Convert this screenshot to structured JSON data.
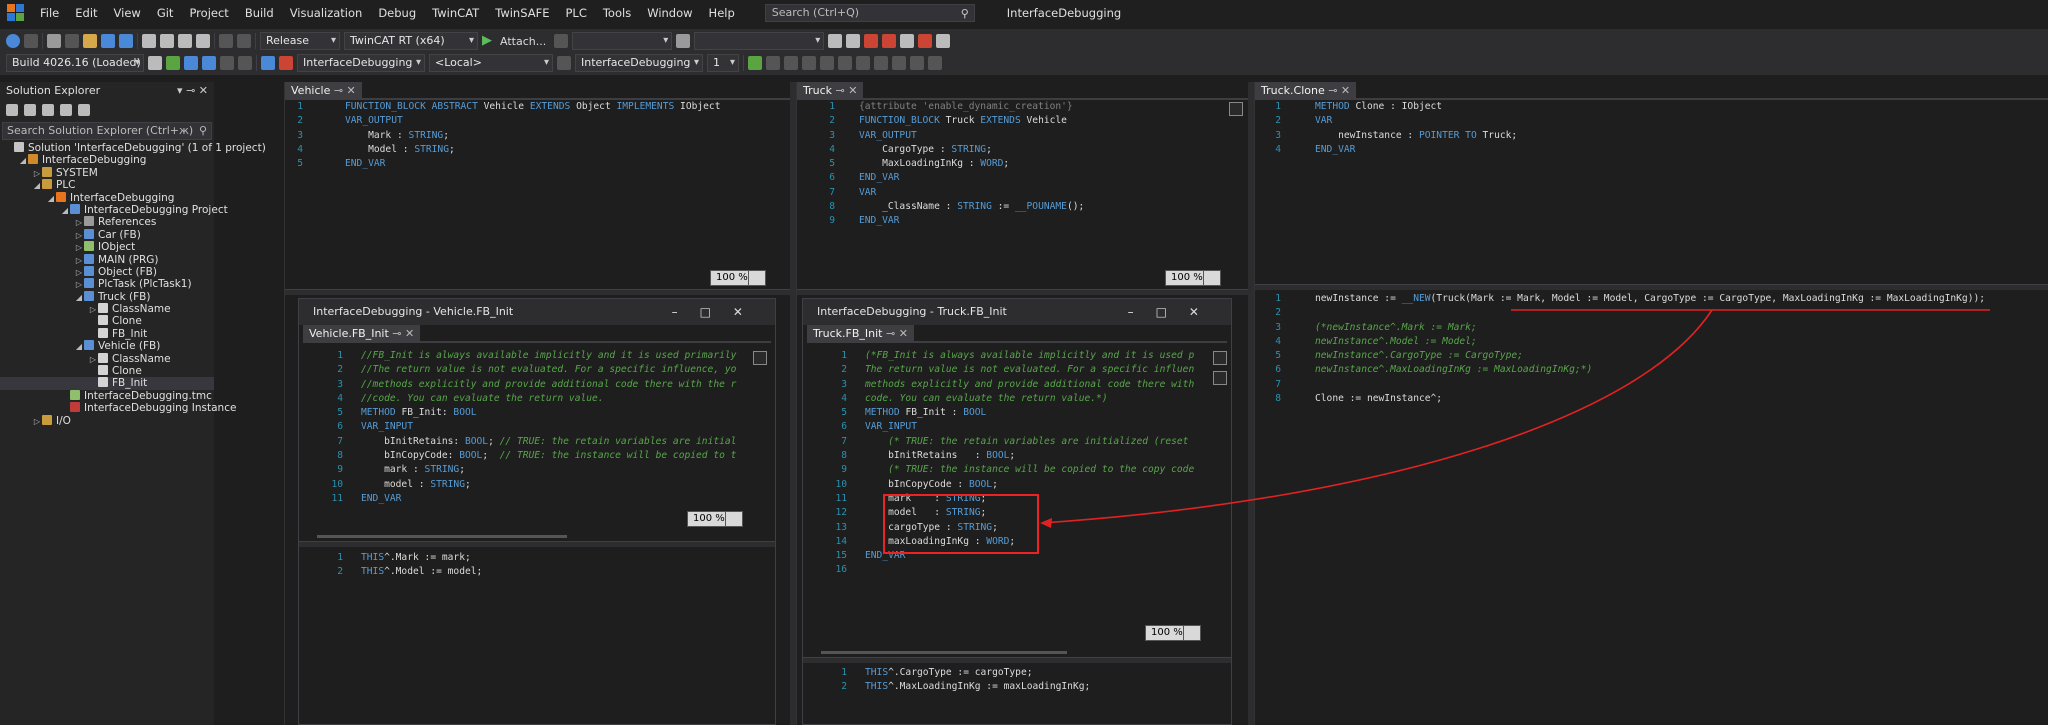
{
  "menubar": {
    "items": [
      "File",
      "Edit",
      "View",
      "Git",
      "Project",
      "Build",
      "Visualization",
      "Debug",
      "TwinCAT",
      "TwinSAFE",
      "PLC",
      "Tools",
      "Window",
      "Help"
    ],
    "search_placeholder": "Search (Ctrl+Q)",
    "app_title": "InterfaceDebugging"
  },
  "toolbar1": {
    "config": "Release",
    "platform": "TwinCAT RT (x64)",
    "attach": "Attach...",
    "empty1": "",
    "empty2": ""
  },
  "toolbar2": {
    "build": "Build 4026.16 (Loaded)",
    "project": "InterfaceDebugging",
    "target": "<Local>",
    "plc": "InterfaceDebugging",
    "task": "1"
  },
  "solution_explorer": {
    "title": "Solution Explorer",
    "search_placeholder": "Search Solution Explorer (Ctrl+ж)",
    "items": [
      {
        "label": "Solution 'InterfaceDebugging' (1 of 1 project)",
        "indent": 0,
        "arrow": "",
        "color": "#c5c5c5"
      },
      {
        "label": "InterfaceDebugging",
        "indent": 1,
        "arrow": "◢",
        "color": "#d08a2a"
      },
      {
        "label": "SYSTEM",
        "indent": 2,
        "arrow": "▷",
        "color": "#c89b3c"
      },
      {
        "label": "PLC",
        "indent": 2,
        "arrow": "◢",
        "color": "#c89b3c"
      },
      {
        "label": "InterfaceDebugging",
        "indent": 3,
        "arrow": "◢",
        "color": "#e8741e"
      },
      {
        "label": "InterfaceDebugging Project",
        "indent": 4,
        "arrow": "◢",
        "color": "#5a8fd6"
      },
      {
        "label": "References",
        "indent": 5,
        "arrow": "▷",
        "color": "#9a9a9a"
      },
      {
        "label": "Car (FB)",
        "indent": 5,
        "arrow": "▷",
        "color": "#5a8fd6"
      },
      {
        "label": "IObject",
        "indent": 5,
        "arrow": "▷",
        "color": "#8fbf6a"
      },
      {
        "label": "MAIN (PRG)",
        "indent": 5,
        "arrow": "▷",
        "color": "#5a8fd6"
      },
      {
        "label": "Object (FB)",
        "indent": 5,
        "arrow": "▷",
        "color": "#5a8fd6"
      },
      {
        "label": "PlcTask (PlcTask1)",
        "indent": 5,
        "arrow": "▷",
        "color": "#5a8fd6"
      },
      {
        "label": "Truck (FB)",
        "indent": 5,
        "arrow": "◢",
        "color": "#5a8fd6"
      },
      {
        "label": "ClassName",
        "indent": 6,
        "arrow": "▷",
        "color": "#d4d4d4"
      },
      {
        "label": "Clone",
        "indent": 6,
        "arrow": "",
        "color": "#d4d4d4"
      },
      {
        "label": "FB_Init",
        "indent": 6,
        "arrow": "",
        "color": "#d4d4d4"
      },
      {
        "label": "Vehicle (FB)",
        "indent": 5,
        "arrow": "◢",
        "color": "#5a8fd6"
      },
      {
        "label": "ClassName",
        "indent": 6,
        "arrow": "▷",
        "color": "#d4d4d4"
      },
      {
        "label": "Clone",
        "indent": 6,
        "arrow": "",
        "color": "#d4d4d4"
      },
      {
        "label": "FB_Init",
        "indent": 6,
        "arrow": "",
        "color": "#d4d4d4",
        "selected": true
      },
      {
        "label": "InterfaceDebugging.tmc",
        "indent": 4,
        "arrow": "",
        "color": "#8fbf6a"
      },
      {
        "label": "InterfaceDebugging Instance",
        "indent": 4,
        "arrow": "",
        "color": "#c23b3b"
      },
      {
        "label": "I/O",
        "indent": 2,
        "arrow": "▷",
        "color": "#c89b3c"
      }
    ]
  },
  "vehicle": {
    "tab": "Vehicle",
    "zoom": "100 %",
    "lines": [
      "1",
      "2",
      "3",
      "4",
      "5"
    ],
    "code": [
      [
        [
          "kw",
          "FUNCTION_BLOCK ABSTRACT "
        ],
        [
          "",
          "Vehicle "
        ],
        [
          "kw",
          "EXTENDS "
        ],
        [
          "",
          "Object "
        ],
        [
          "kw",
          "IMPLEMENTS "
        ],
        [
          "",
          "IObject"
        ]
      ],
      [
        [
          "kw",
          "VAR_OUTPUT"
        ]
      ],
      [
        [
          "",
          "    Mark : "
        ],
        [
          "kw",
          "STRING"
        ],
        [
          "",
          ";"
        ]
      ],
      [
        [
          "",
          "    Model : "
        ],
        [
          "kw",
          "STRING"
        ],
        [
          "",
          ";"
        ]
      ],
      [
        [
          "kw",
          "END_VAR"
        ]
      ]
    ]
  },
  "truck": {
    "tab": "Truck",
    "zoom": "100 %",
    "lines": [
      "1",
      "2",
      "3",
      "4",
      "5",
      "6",
      "7",
      "8",
      "9"
    ],
    "code": [
      [
        [
          "gray",
          "{attribute 'enable_dynamic_creation'}"
        ]
      ],
      [
        [
          "kw",
          "FUNCTION_BLOCK "
        ],
        [
          "",
          "Truck "
        ],
        [
          "kw",
          "EXTENDS "
        ],
        [
          "",
          "Vehicle"
        ]
      ],
      [
        [
          "kw",
          "VAR_OUTPUT"
        ]
      ],
      [
        [
          "",
          "    CargoType : "
        ],
        [
          "kw",
          "STRING"
        ],
        [
          "",
          ";"
        ]
      ],
      [
        [
          "",
          "    MaxLoadingInKg : "
        ],
        [
          "kw",
          "WORD"
        ],
        [
          "",
          ";"
        ]
      ],
      [
        [
          "kw",
          "END_VAR"
        ]
      ],
      [
        [
          "kw",
          "VAR"
        ]
      ],
      [
        [
          "",
          "    _ClassName : "
        ],
        [
          "kw",
          "STRING "
        ],
        [
          "",
          ":= "
        ],
        [
          "kw",
          "__POUNAME"
        ],
        [
          "",
          "();"
        ]
      ],
      [
        [
          "kw",
          "END_VAR"
        ]
      ]
    ]
  },
  "clone": {
    "tab": "Truck.Clone",
    "lines_top": [
      "1",
      "2",
      "3",
      "4"
    ],
    "code_top": [
      [
        [
          "kw",
          "METHOD "
        ],
        [
          "",
          "Clone : IObject"
        ]
      ],
      [
        [
          "kw",
          "VAR"
        ]
      ],
      [
        [
          "",
          "    newInstance : "
        ],
        [
          "kw",
          "POINTER TO "
        ],
        [
          "",
          "Truck;"
        ]
      ],
      [
        [
          "kw",
          "END_VAR"
        ]
      ]
    ],
    "lines_bottom": [
      "1",
      "2",
      "3",
      "4",
      "5",
      "6",
      "7",
      "8"
    ],
    "code_bottom": [
      [
        [
          "",
          "newInstance := "
        ],
        [
          "kw",
          "__NEW"
        ],
        [
          "",
          "(Truck(Mark := Mark, Model := Model, CargoType := CargoType, MaxLoadingInKg := MaxLoadingInKg));"
        ]
      ],
      [
        [
          "",
          ""
        ]
      ],
      [
        [
          "cm",
          "(*newInstance^.Mark := Mark;"
        ]
      ],
      [
        [
          "cm",
          "newInstance^.Model := Model;"
        ]
      ],
      [
        [
          "cm",
          "newInstance^.CargoType := CargoType;"
        ]
      ],
      [
        [
          "cm",
          "newInstance^.MaxLoadingInKg := MaxLoadingInKg;*)"
        ]
      ],
      [
        [
          "",
          ""
        ]
      ],
      [
        [
          "",
          "Clone := newInstance^;"
        ]
      ]
    ]
  },
  "vehicle_fbinit": {
    "window_title": "InterfaceDebugging - Vehicle.FB_Init",
    "tab": "Vehicle.FB_Init",
    "zoom": "100 %",
    "lines": [
      "1",
      "2",
      "3",
      "4",
      "5",
      "6",
      "7",
      "8",
      "9",
      "10",
      "11"
    ],
    "code": [
      [
        [
          "cm",
          "//FB_Init is always available implicitly and it is used primarily"
        ]
      ],
      [
        [
          "cm",
          "//The return value is not evaluated. For a specific influence, yo"
        ]
      ],
      [
        [
          "cm",
          "//methods explicitly and provide additional code there with the r"
        ]
      ],
      [
        [
          "cm",
          "//code. You can evaluate the return value."
        ]
      ],
      [
        [
          "kw",
          "METHOD "
        ],
        [
          "",
          "FB_Init: "
        ],
        [
          "kw",
          "BOOL"
        ]
      ],
      [
        [
          "kw",
          "VAR_INPUT"
        ]
      ],
      [
        [
          "",
          "    bInitRetains: "
        ],
        [
          "kw",
          "BOOL"
        ],
        [
          "",
          "; "
        ],
        [
          "cm",
          "// TRUE: the retain variables are initial"
        ]
      ],
      [
        [
          "",
          "    bInCopyCode: "
        ],
        [
          "kw",
          "BOOL"
        ],
        [
          "",
          ";  "
        ],
        [
          "cm",
          "// TRUE: the instance will be copied to t"
        ]
      ],
      [
        [
          "",
          "    mark : "
        ],
        [
          "kw",
          "STRING"
        ],
        [
          "",
          ";"
        ]
      ],
      [
        [
          "",
          "    model : "
        ],
        [
          "kw",
          "STRING"
        ],
        [
          "",
          ";"
        ]
      ],
      [
        [
          "kw",
          "END_VAR"
        ]
      ]
    ],
    "lines_bottom": [
      "1",
      "2"
    ],
    "code_bottom": [
      [
        [
          "kw",
          "THIS"
        ],
        [
          "",
          "^.Mark := mark;"
        ]
      ],
      [
        [
          "kw",
          "THIS"
        ],
        [
          "",
          "^.Model := model;"
        ]
      ]
    ]
  },
  "truck_fbinit": {
    "window_title": "InterfaceDebugging - Truck.FB_Init",
    "tab": "Truck.FB_Init",
    "zoom": "100 %",
    "lines": [
      "1",
      "2",
      "3",
      "4",
      "5",
      "6",
      "7",
      "8",
      "9",
      "10",
      "11",
      "12",
      "13",
      "14",
      "15",
      "16"
    ],
    "code": [
      [
        [
          "cm",
          "(*FB_Init is always available implicitly and it is used p"
        ]
      ],
      [
        [
          "cm",
          "The return value is not evaluated. For a specific influen"
        ]
      ],
      [
        [
          "cm",
          "methods explicitly and provide additional code there with"
        ]
      ],
      [
        [
          "cm",
          "code. You can evaluate the return value.*)"
        ]
      ],
      [
        [
          "kw",
          "METHOD "
        ],
        [
          "",
          "FB_Init : "
        ],
        [
          "kw",
          "BOOL"
        ]
      ],
      [
        [
          "kw",
          "VAR_INPUT"
        ]
      ],
      [
        [
          "cm",
          "    (* TRUE: the retain variables are initialized (reset"
        ]
      ],
      [
        [
          "",
          "    bInitRetains   : "
        ],
        [
          "kw",
          "BOOL"
        ],
        [
          "",
          ";"
        ]
      ],
      [
        [
          "cm",
          "    (* TRUE: the instance will be copied to the copy code"
        ]
      ],
      [
        [
          "",
          "    bInCopyCode : "
        ],
        [
          "kw",
          "BOOL"
        ],
        [
          "",
          ";"
        ]
      ],
      [
        [
          "",
          "    mark    : "
        ],
        [
          "kw",
          "STRING"
        ],
        [
          "",
          ";"
        ]
      ],
      [
        [
          "",
          "    model   : "
        ],
        [
          "kw",
          "STRING"
        ],
        [
          "",
          ";"
        ]
      ],
      [
        [
          "",
          "    cargoType : "
        ],
        [
          "kw",
          "STRING"
        ],
        [
          "",
          ";"
        ]
      ],
      [
        [
          "",
          "    maxLoadingInKg : "
        ],
        [
          "kw",
          "WORD"
        ],
        [
          "",
          ";"
        ]
      ],
      [
        [
          "kw",
          "END_VAR"
        ]
      ],
      [
        [
          "",
          ""
        ]
      ]
    ],
    "lines_bottom": [
      "1",
      "2"
    ],
    "code_bottom": [
      [
        [
          "kw",
          "THIS"
        ],
        [
          "",
          "^.CargoType := cargoType;"
        ]
      ],
      [
        [
          "kw",
          "THIS"
        ],
        [
          "",
          "^.MaxLoadingInKg := maxLoadingInKg;"
        ]
      ]
    ]
  },
  "colors": {
    "keyword": "#569cd6",
    "comment": "#57a64a",
    "line_number": "#2b91af",
    "annotation": "#e22222"
  }
}
